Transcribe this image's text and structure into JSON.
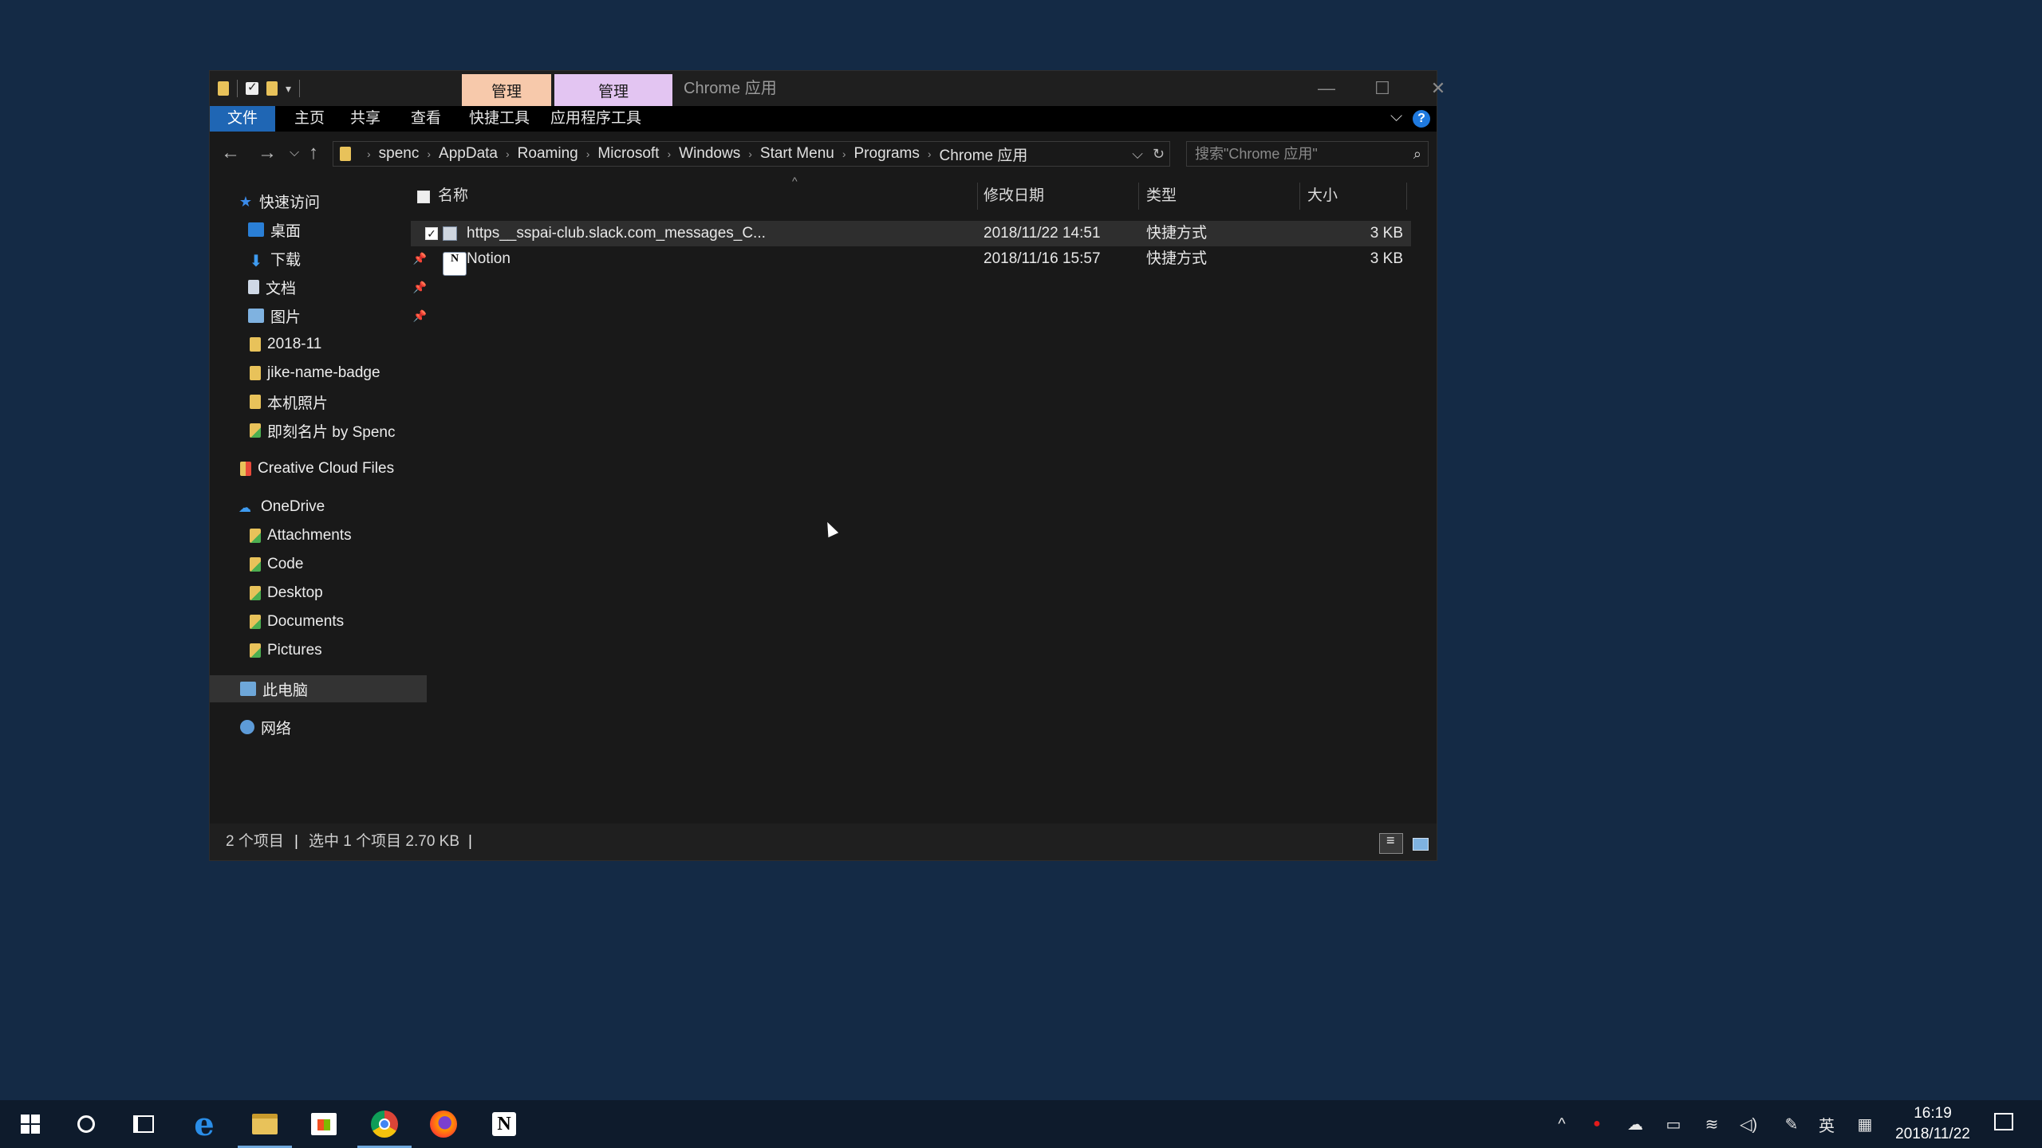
{
  "window": {
    "title": "Chrome 应用",
    "context_tabs": [
      "管理",
      "管理"
    ],
    "ribbon_tabs": [
      "文件",
      "主页",
      "共享",
      "查看",
      "快捷工具",
      "应用程序工具"
    ]
  },
  "address": {
    "crumbs": [
      "spenc",
      "AppData",
      "Roaming",
      "Microsoft",
      "Windows",
      "Start Menu",
      "Programs",
      "Chrome 应用"
    ],
    "search_placeholder": "搜索\"Chrome 应用\""
  },
  "sidebar": {
    "items": [
      {
        "label": "快速访问",
        "icon": "star-icon"
      },
      {
        "label": "桌面",
        "icon": "desktop-icon",
        "pinned": true
      },
      {
        "label": "下载",
        "icon": "download-icon",
        "pinned": true
      },
      {
        "label": "文档",
        "icon": "document-icon",
        "pinned": true
      },
      {
        "label": "图片",
        "icon": "picture-icon",
        "pinned": true
      },
      {
        "label": "2018-11",
        "icon": "folder-icon"
      },
      {
        "label": "jike-name-badge",
        "icon": "folder-icon"
      },
      {
        "label": "本机照片",
        "icon": "folder-icon"
      },
      {
        "label": "即刻名片 by Spenc",
        "icon": "folder-icon"
      },
      {
        "label": "Creative Cloud Files",
        "icon": "creative-cloud-icon"
      },
      {
        "label": "OneDrive",
        "icon": "cloud-icon"
      },
      {
        "label": "Attachments",
        "icon": "folder-icon"
      },
      {
        "label": "Code",
        "icon": "folder-icon"
      },
      {
        "label": "Desktop",
        "icon": "folder-icon"
      },
      {
        "label": "Documents",
        "icon": "folder-icon"
      },
      {
        "label": "Pictures",
        "icon": "folder-icon"
      },
      {
        "label": "此电脑",
        "icon": "computer-icon",
        "selected": true
      },
      {
        "label": "网络",
        "icon": "network-icon"
      }
    ]
  },
  "columns": [
    "名称",
    "修改日期",
    "类型",
    "大小"
  ],
  "files": [
    {
      "name": "https__sspai-club.slack.com_messages_C...",
      "date": "2018/11/22 14:51",
      "type": "快捷方式",
      "size": "3 KB",
      "selected": true
    },
    {
      "name": "Notion",
      "date": "2018/11/16 15:57",
      "type": "快捷方式",
      "size": "3 KB",
      "selected": false
    }
  ],
  "status": {
    "count": "2 个项目",
    "selection": "选中 1 个项目  2.70 KB"
  },
  "taskbar": {
    "time": "16:19",
    "date": "2018/11/22",
    "ime": "英"
  }
}
